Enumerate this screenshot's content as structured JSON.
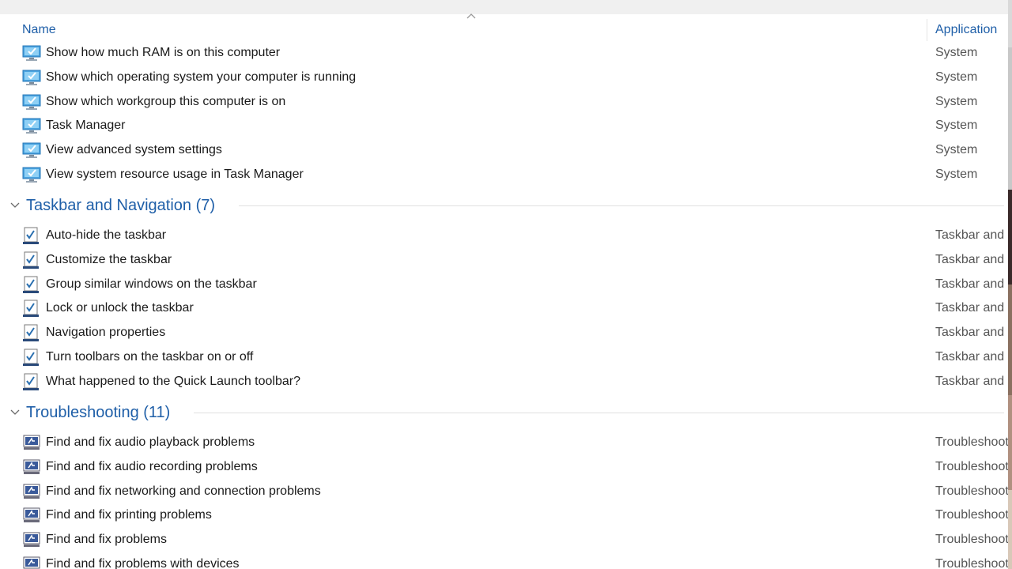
{
  "header": {
    "name_label": "Name",
    "app_label": "Application"
  },
  "system_items": [
    {
      "label": "Show how much RAM is on this computer",
      "category": "System",
      "icon": "monitor-check-icon"
    },
    {
      "label": "Show which operating system your computer is running",
      "category": "System",
      "icon": "monitor-check-icon"
    },
    {
      "label": "Show which workgroup this computer is on",
      "category": "System",
      "icon": "monitor-check-icon"
    },
    {
      "label": "Task Manager",
      "category": "System",
      "icon": "monitor-check-icon"
    },
    {
      "label": "View advanced system settings",
      "category": "System",
      "icon": "monitor-check-icon"
    },
    {
      "label": "View system resource usage in Task Manager",
      "category": "System",
      "icon": "monitor-check-icon"
    }
  ],
  "groups": {
    "taskbar": {
      "title": "Taskbar and Navigation (7)",
      "items": [
        {
          "label": "Auto-hide the taskbar",
          "category": "Taskbar and Navigation"
        },
        {
          "label": "Customize the taskbar",
          "category": "Taskbar and Navigation"
        },
        {
          "label": "Group similar windows on the taskbar",
          "category": "Taskbar and Navigation"
        },
        {
          "label": "Lock or unlock the taskbar",
          "category": "Taskbar and Navigation"
        },
        {
          "label": "Navigation properties",
          "category": "Taskbar and Navigation"
        },
        {
          "label": "Turn toolbars on the taskbar on or off",
          "category": "Taskbar and Navigation"
        },
        {
          "label": "What happened to the Quick Launch toolbar?",
          "category": "Taskbar and Navigation"
        }
      ]
    },
    "troubleshooting": {
      "title": "Troubleshooting (11)",
      "items": [
        {
          "label": "Find and fix audio playback problems",
          "category": "Troubleshooting"
        },
        {
          "label": "Find and fix audio recording problems",
          "category": "Troubleshooting"
        },
        {
          "label": "Find and fix networking and connection problems",
          "category": "Troubleshooting"
        },
        {
          "label": "Find and fix printing problems",
          "category": "Troubleshooting"
        },
        {
          "label": "Find and fix problems",
          "category": "Troubleshooting"
        },
        {
          "label": "Find and fix problems with devices",
          "category": "Troubleshooting"
        }
      ]
    }
  },
  "colors": {
    "link_blue": "#1f5fa8",
    "group_title": "#1f5fa8",
    "secondary_text": "#555555"
  }
}
